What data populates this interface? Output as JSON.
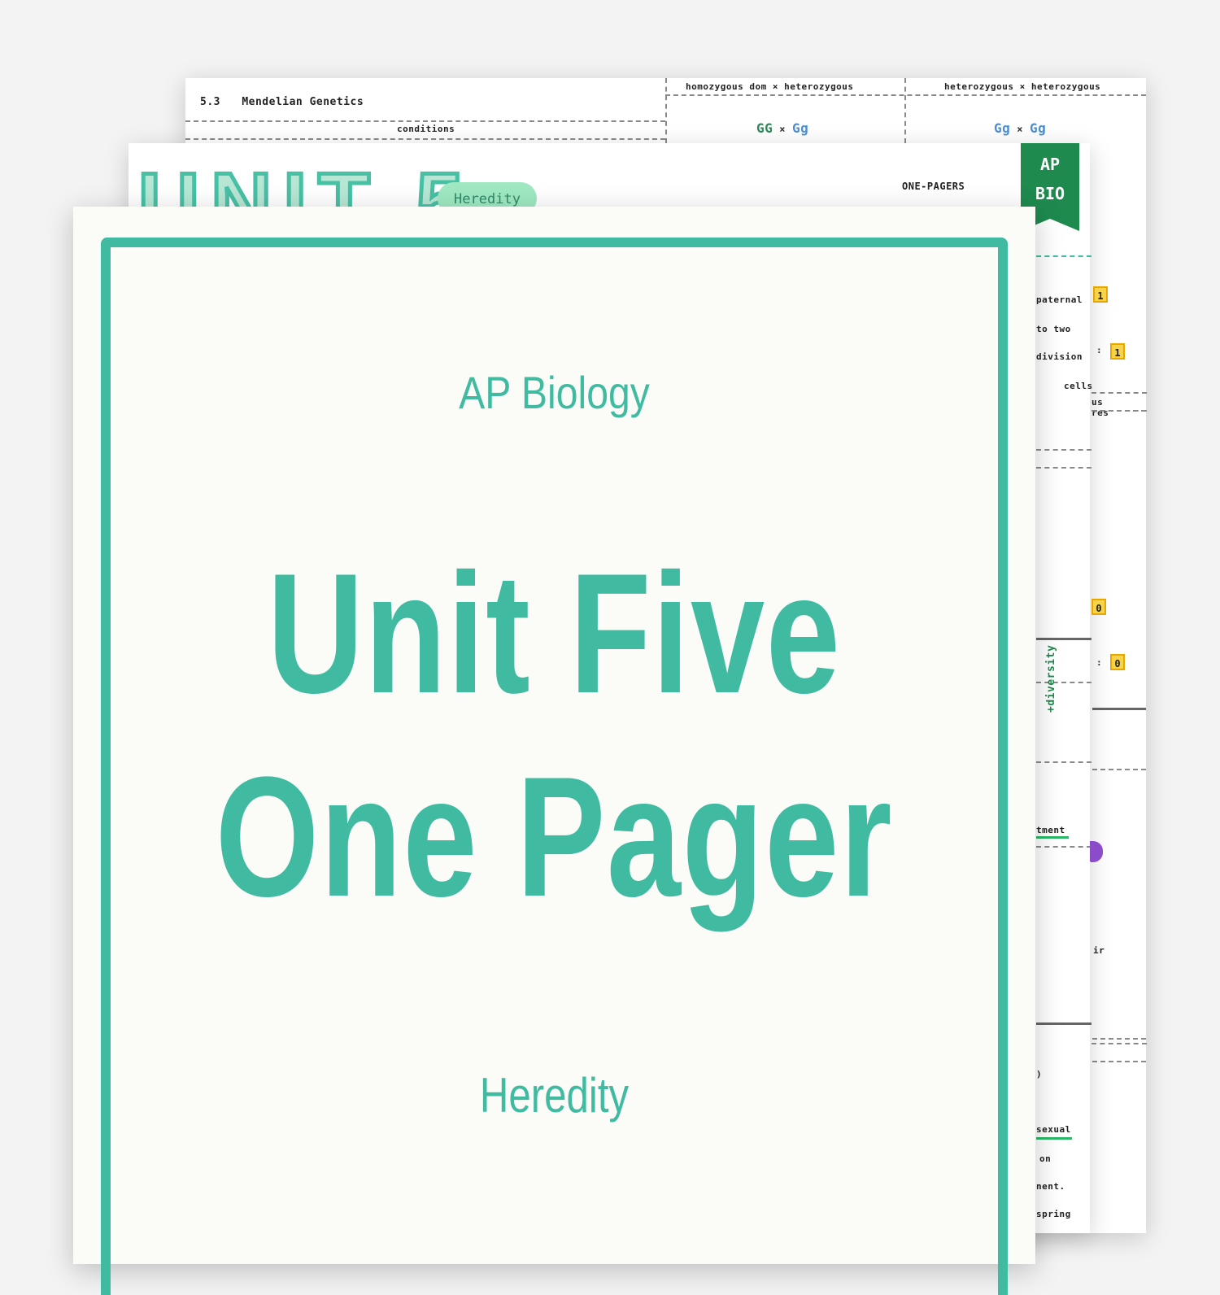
{
  "back_sheet": {
    "section_number": "5.3",
    "section_title": "Mendelian Genetics",
    "conditions_label": "conditions",
    "cross_headers": [
      "homozygous dom × heterozygous",
      "heterozygous × heterozygous"
    ],
    "cross1": {
      "a": "GG",
      "x": "×",
      "b": "Gg"
    },
    "cross2": {
      "a": "Gg",
      "x": "×",
      "b": "Gg"
    }
  },
  "mid_sheet": {
    "unit_title": "UNIT 5",
    "topic_pill": "Heredity",
    "category": "ONE-PAGERS",
    "ribbon": {
      "line1": "AP",
      "line2": "BIO"
    },
    "fragments": {
      "paternal": "paternal",
      "to_two": "to two",
      "division": "division",
      "cells": "cells",
      "res": "us res",
      "tment": "tment",
      "ir": "ir",
      "sexual": "sexual",
      "on": "on",
      "nent": "nent.",
      "spring": "spring",
      "paren": ")",
      "colon1": ":",
      "colon2": ":"
    },
    "boxes": [
      "1",
      "1",
      "0",
      "0"
    ],
    "diversity_note": "+diversity"
  },
  "cover": {
    "course": "AP Biology",
    "title_line1": "Unit Five",
    "title_line2": "One Pager",
    "subtitle": "Heredity"
  },
  "colors": {
    "accent": "#40bba1",
    "cover_bg": "#fbfcf7",
    "ribbon": "#1e8a4e",
    "pill": "#9fe8c2",
    "highlight": "#f7d34a"
  }
}
